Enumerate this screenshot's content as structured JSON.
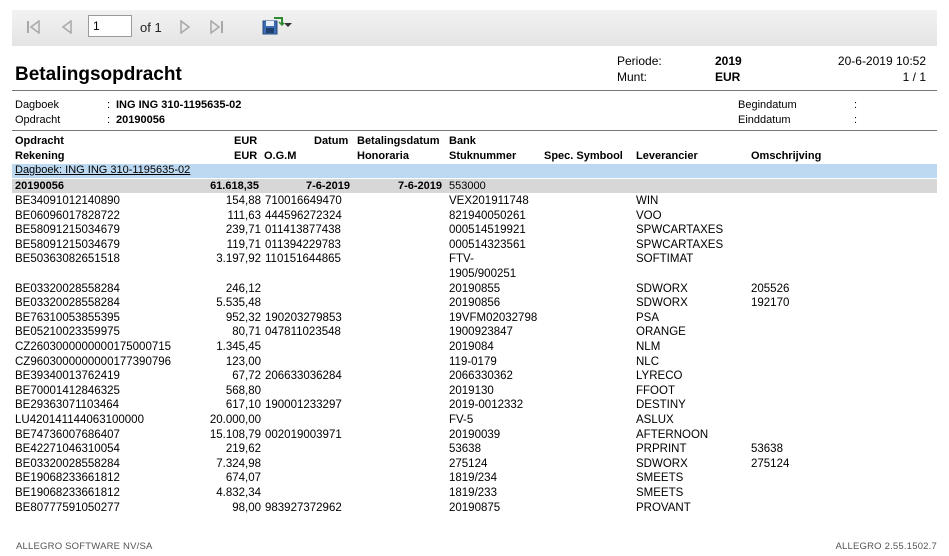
{
  "toolbar": {
    "page_value": "1",
    "of_label": "of 1",
    "icons": [
      "first-page-icon",
      "previous-page-icon",
      "next-page-icon",
      "last-page-icon",
      "export-icon",
      "dropdown-arrow-icon"
    ]
  },
  "report": {
    "title": "Betalingsopdracht",
    "periode_label": "Periode:",
    "periode_value": "2019",
    "munt_label": "Munt:",
    "munt_value": "EUR",
    "datetime": "20-6-2019 10:52",
    "page_count": "1 / 1",
    "dagboek_label": "Dagboek",
    "dagboek_value": "ING ING  310-1195635-02",
    "opdracht_label": "Opdracht",
    "opdracht_value": "20190056",
    "begindatum_label": "Begindatum",
    "einddatum_label": "Einddatum",
    "colon": ":"
  },
  "headers": {
    "opdracht": "Opdracht",
    "rekening": "Rekening",
    "eur1": "EUR",
    "eur2": "EUR",
    "datum": "Datum",
    "ogm": "O.G.M",
    "betalingsdatum": "Betalingsdatum",
    "honoraria": "Honoraria",
    "bank": "Bank",
    "stuknummer": "Stuknummer",
    "spec_symbool": "Spec. Symbool",
    "leverancier": "Leverancier",
    "omschrijving": "Omschrijving"
  },
  "group": {
    "dagboek_text": "Dagboek: ING ING  310-1195635-02"
  },
  "summary": {
    "opdracht": "20190056",
    "amount": "61.618,35",
    "datum": "7-6-2019",
    "betalingsdatum": "7-6-2019",
    "bank": "553000"
  },
  "rows": [
    {
      "rekening": "BE34091012140890",
      "eur": "154,88",
      "ogm": "710016649470",
      "stuk": "VEX201911748",
      "stuk2": "",
      "lev": "WIN",
      "oms": ""
    },
    {
      "rekening": "BE06096017828722",
      "eur": "111,63",
      "ogm": "444596272324",
      "stuk": "821940050261",
      "stuk2": "",
      "lev": "VOO",
      "oms": ""
    },
    {
      "rekening": "BE58091215034679",
      "eur": "239,71",
      "ogm": "011413877438",
      "stuk": "000514519921",
      "stuk2": "",
      "lev": "SPWCARTAXES",
      "oms": ""
    },
    {
      "rekening": "BE58091215034679",
      "eur": "119,71",
      "ogm": "011394229783",
      "stuk": "000514323561",
      "stuk2": "",
      "lev": "SPWCARTAXES",
      "oms": ""
    },
    {
      "rekening": "BE50363082651518",
      "eur": "3.197,92",
      "ogm": "110151644865",
      "stuk": "FTV-",
      "stuk2": "1905/900251",
      "lev": "SOFTIMAT",
      "oms": ""
    },
    {
      "rekening": "BE03320028558284",
      "eur": "246,12",
      "ogm": "",
      "stuk": "20190855",
      "stuk2": "",
      "lev": "SDWORX",
      "oms": "205526"
    },
    {
      "rekening": "BE03320028558284",
      "eur": "5.535,48",
      "ogm": "",
      "stuk": "20190856",
      "stuk2": "",
      "lev": "SDWORX",
      "oms": "192170"
    },
    {
      "rekening": "BE76310053855395",
      "eur": "952,32",
      "ogm": "190203279853",
      "stuk": "19VFM02032798",
      "stuk2": "",
      "lev": "PSA",
      "oms": ""
    },
    {
      "rekening": "BE05210023359975",
      "eur": "80,71",
      "ogm": "047811023548",
      "stuk": "1900923847",
      "stuk2": "",
      "lev": "ORANGE",
      "oms": ""
    },
    {
      "rekening": "CZ2603000000000175000715",
      "eur": "1.345,45",
      "ogm": "",
      "stuk": "2019084",
      "stuk2": "",
      "lev": "NLM",
      "oms": ""
    },
    {
      "rekening": "CZ9603000000000177390796",
      "eur": "123,00",
      "ogm": "",
      "stuk": "119-0179",
      "stuk2": "",
      "lev": "NLC",
      "oms": ""
    },
    {
      "rekening": "BE39340013762419",
      "eur": "67,72",
      "ogm": "206633036284",
      "stuk": "2066330362",
      "stuk2": "",
      "lev": "LYRECO",
      "oms": ""
    },
    {
      "rekening": "BE70001412846325",
      "eur": "568,80",
      "ogm": "",
      "stuk": "2019130",
      "stuk2": "",
      "lev": "FFOOT",
      "oms": ""
    },
    {
      "rekening": "BE29363071103464",
      "eur": "617,10",
      "ogm": "190001233297",
      "stuk": "2019-0012332",
      "stuk2": "",
      "lev": "DESTINY",
      "oms": ""
    },
    {
      "rekening": "LU420141144063100000",
      "eur": "20.000,00",
      "ogm": "",
      "stuk": "FV-5",
      "stuk2": "",
      "lev": "ASLUX",
      "oms": ""
    },
    {
      "rekening": "BE74736007686407",
      "eur": "15.108,79",
      "ogm": "002019003971",
      "stuk": "20190039",
      "stuk2": "",
      "lev": "AFTERNOON",
      "oms": ""
    },
    {
      "rekening": "BE42271046310054",
      "eur": "219,62",
      "ogm": "",
      "stuk": "53638",
      "stuk2": "",
      "lev": "PRPRINT",
      "oms": "53638"
    },
    {
      "rekening": "BE03320028558284",
      "eur": "7.324,98",
      "ogm": "",
      "stuk": "275124",
      "stuk2": "",
      "lev": "SDWORX",
      "oms": "275124"
    },
    {
      "rekening": "BE19068233661812",
      "eur": "674,07",
      "ogm": "",
      "stuk": "1819/234",
      "stuk2": "",
      "lev": "SMEETS",
      "oms": ""
    },
    {
      "rekening": "BE19068233661812",
      "eur": "4.832,34",
      "ogm": "",
      "stuk": "1819/233",
      "stuk2": "",
      "lev": "SMEETS",
      "oms": ""
    },
    {
      "rekening": "BE80777591050277",
      "eur": "98,00",
      "ogm": "983927372962",
      "stuk": "20190875",
      "stuk2": "",
      "lev": "PROVANT",
      "oms": ""
    }
  ],
  "footer": {
    "company": "ALLEGRO SOFTWARE NV/SA",
    "version": "ALLEGRO 2.55.1502.7"
  }
}
